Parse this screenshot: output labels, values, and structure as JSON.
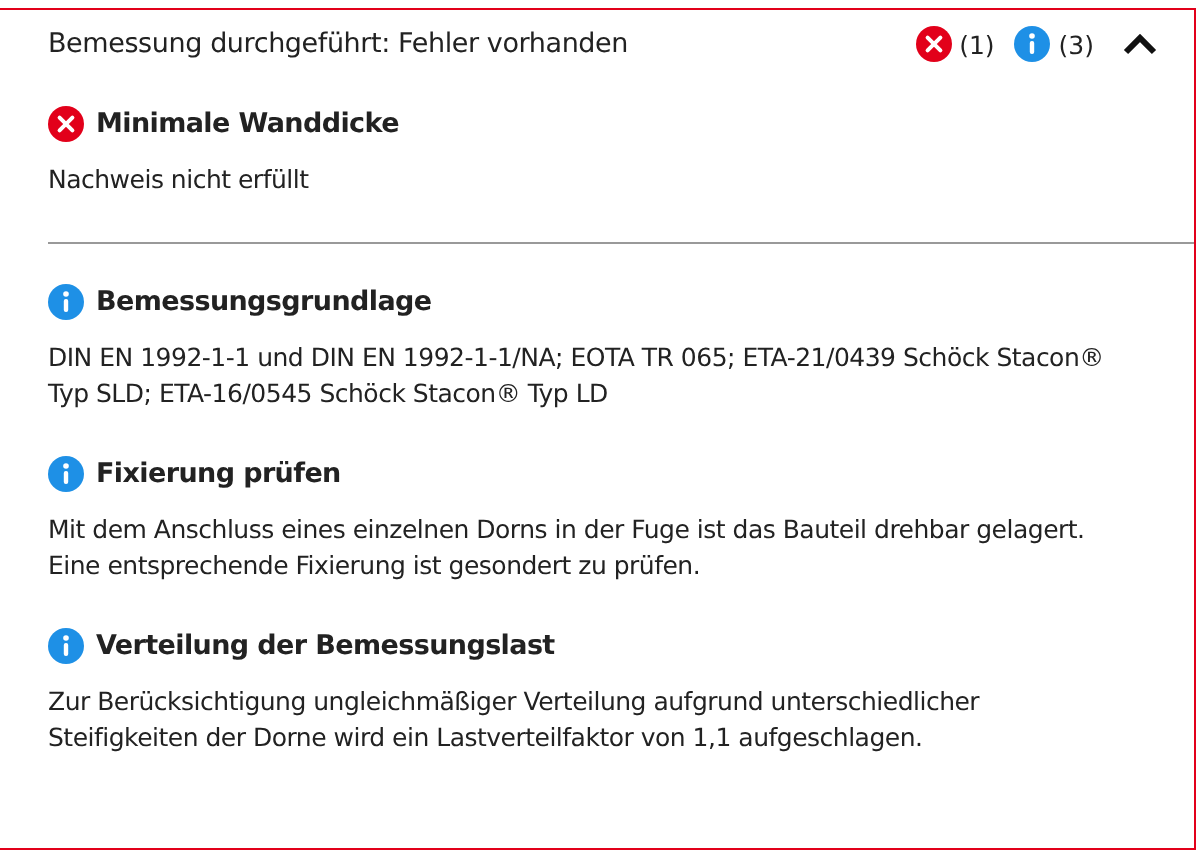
{
  "panel": {
    "title": "Bemessung durchgeführt: Fehler vorhanden",
    "expanded": true,
    "counts": [
      {
        "kind": "error",
        "count": "(1)"
      },
      {
        "kind": "info",
        "count": "(3)"
      }
    ]
  },
  "groups": [
    {
      "messages": [
        {
          "kind": "error",
          "title": "Minimale Wanddicke",
          "text": "Nachweis nicht erfüllt"
        }
      ]
    },
    {
      "messages": [
        {
          "kind": "info",
          "title": "Bemessungsgrundlage",
          "text": "DIN EN 1992-1-1 und DIN EN 1992-1-1/NA; EOTA TR 065; ETA-21/0439 Schöck Stacon® Typ SLD; ETA-16/0545 Schöck Stacon® Typ LD"
        },
        {
          "kind": "info",
          "title": "Fixierung prüfen",
          "text": "Mit dem Anschluss eines einzelnen Dorns in der Fuge ist das Bauteil drehbar gelagert. Eine entsprechende Fixierung ist gesondert zu prüfen."
        },
        {
          "kind": "info",
          "title": "Verteilung der Bemessungslast",
          "text": "Zur Berücksichtigung ungleichmäßiger Verteilung aufgrund unterschiedlicher Steifigkeiten der Dorne wird ein Lastverteilfaktor von 1,1 aufgeschlagen."
        }
      ]
    }
  ]
}
